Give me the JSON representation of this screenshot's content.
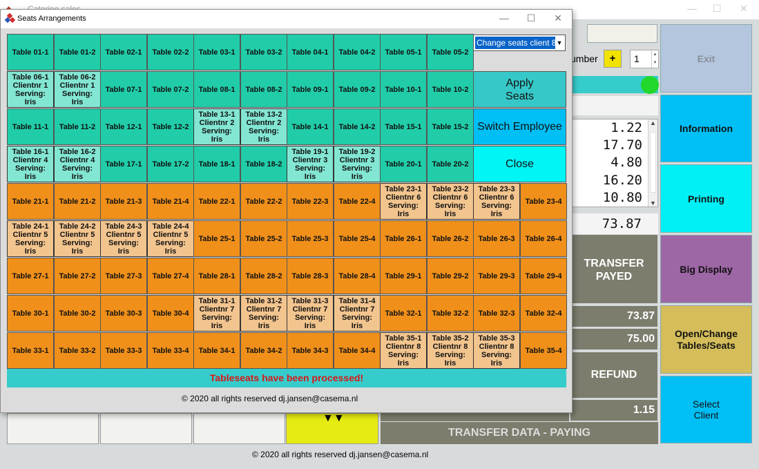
{
  "background": {
    "title": "Catering sales",
    "number_label": "umber",
    "plus_label": "+",
    "quantity": "1",
    "amounts": [
      "1.22",
      "17.70",
      "4.80",
      "16.20",
      "10.80"
    ],
    "total": "73.87",
    "transfer_payed": "TRANSFER PAYED",
    "value1": "73.87",
    "value2": "75.00",
    "refund": "REFUND",
    "value3": "1.15",
    "transfer_data": "TRANSFER DATA - PAYING",
    "side_buttons": {
      "exit": "Exit",
      "information": "Information",
      "printing": "Printing",
      "big_display": "Big Display",
      "open_change": "Open/Change Tables/Seats",
      "select_client": "Select Client"
    },
    "copyright": "© 2020 all rights reserved dj.jansen@casema.nl"
  },
  "dialog": {
    "title": "Seats Arrangements",
    "select_value": "Change seats client 8",
    "apply_label": "Apply Seats",
    "switch_label": "Switch Employee",
    "close_label": "Close",
    "status": "Tableseats have been processed!",
    "copyright": "© 2020 all rights reserved dj.jansen@casema.nl",
    "colors": {
      "teal": "#21cda9",
      "orange": "#f0901a",
      "teal_assigned": "#82e6d2",
      "orange_assigned": "#f2c48e"
    },
    "rows": [
      [
        {
          "label": "Table 01-1"
        },
        {
          "label": "Table 01-2"
        },
        {
          "label": "Table 02-1"
        },
        {
          "label": "Table 02-2"
        },
        {
          "label": "Table 03-1"
        },
        {
          "label": "Table 03-2"
        },
        {
          "label": "Table 04-1"
        },
        {
          "label": "Table 04-2"
        },
        {
          "label": "Table 05-1"
        },
        {
          "label": "Table 05-2"
        }
      ],
      [
        {
          "label": "Table 06-1",
          "client": "Clientnr 1",
          "serving": "Serving:",
          "server": "Iris"
        },
        {
          "label": "Table 06-2",
          "client": "Clientnr 1",
          "serving": "Serving:",
          "server": "Iris"
        },
        {
          "label": "Table 07-1"
        },
        {
          "label": "Table 07-2"
        },
        {
          "label": "Table 08-1"
        },
        {
          "label": "Table 08-2"
        },
        {
          "label": "Table 09-1"
        },
        {
          "label": "Table 09-2"
        },
        {
          "label": "Table 10-1"
        },
        {
          "label": "Table 10-2"
        }
      ],
      [
        {
          "label": "Table 11-1"
        },
        {
          "label": "Table 11-2"
        },
        {
          "label": "Table 12-1"
        },
        {
          "label": "Table 12-2"
        },
        {
          "label": "Table 13-1",
          "client": "Clientnr 2",
          "serving": "Serving:",
          "server": "Iris"
        },
        {
          "label": "Table 13-2",
          "client": "Clientnr 2",
          "serving": "Serving:",
          "server": "Iris"
        },
        {
          "label": "Table 14-1"
        },
        {
          "label": "Table 14-2"
        },
        {
          "label": "Table 15-1"
        },
        {
          "label": "Table 15-2"
        }
      ],
      [
        {
          "label": "Table 16-1",
          "client": "Clientnr 4",
          "serving": "Serving:",
          "server": "Iris"
        },
        {
          "label": "Table 16-2",
          "client": "Clientnr 4",
          "serving": "Serving:",
          "server": "Iris"
        },
        {
          "label": "Table 17-1"
        },
        {
          "label": "Table 17-2"
        },
        {
          "label": "Table 18-1"
        },
        {
          "label": "Table 18-2"
        },
        {
          "label": "Table 19-1",
          "client": "Clientnr 3",
          "serving": "Serving:",
          "server": "Iris"
        },
        {
          "label": "Table 19-2",
          "client": "Clientnr 3",
          "serving": "Serving:",
          "server": "Iris"
        },
        {
          "label": "Table 20-1"
        },
        {
          "label": "Table 20-2"
        }
      ],
      [
        {
          "label": "Table 21-1"
        },
        {
          "label": "Table 21-2"
        },
        {
          "label": "Table 21-3"
        },
        {
          "label": "Table 21-4"
        },
        {
          "label": "Table 22-1"
        },
        {
          "label": "Table 22-2"
        },
        {
          "label": "Table 22-3"
        },
        {
          "label": "Table 22-4"
        },
        {
          "label": "Table 23-1",
          "client": "Clientnr 6",
          "serving": "Serving:",
          "server": "Iris"
        },
        {
          "label": "Table 23-2",
          "client": "Clientnr 6",
          "serving": "Serving:",
          "server": "Iris"
        },
        {
          "label": "Table 23-3",
          "client": "Clientnr 6",
          "serving": "Serving:",
          "server": "Iris"
        },
        {
          "label": "Table 23-4"
        }
      ],
      [
        {
          "label": "Table 24-1",
          "client": "Clientnr 5",
          "serving": "Serving:",
          "server": "Iris"
        },
        {
          "label": "Table 24-2",
          "client": "Clientnr 5",
          "serving": "Serving:",
          "server": "Iris"
        },
        {
          "label": "Table 24-3",
          "client": "Clientnr 5",
          "serving": "Serving:",
          "server": "Iris"
        },
        {
          "label": "Table 24-4",
          "client": "Clientnr 5",
          "serving": "Serving:",
          "server": "Iris"
        },
        {
          "label": "Table 25-1"
        },
        {
          "label": "Table 25-2"
        },
        {
          "label": "Table 25-3"
        },
        {
          "label": "Table 25-4"
        },
        {
          "label": "Table 26-1"
        },
        {
          "label": "Table 26-2"
        },
        {
          "label": "Table 26-3"
        },
        {
          "label": "Table 26-4"
        }
      ],
      [
        {
          "label": "Table 27-1"
        },
        {
          "label": "Table 27-2"
        },
        {
          "label": "Table 27-3"
        },
        {
          "label": "Table 27-4"
        },
        {
          "label": "Table 28-1"
        },
        {
          "label": "Table 28-2"
        },
        {
          "label": "Table 28-3"
        },
        {
          "label": "Table 28-4"
        },
        {
          "label": "Table 29-1"
        },
        {
          "label": "Table 29-2"
        },
        {
          "label": "Table 29-3"
        },
        {
          "label": "Table 29-4"
        }
      ],
      [
        {
          "label": "Table 30-1"
        },
        {
          "label": "Table 30-2"
        },
        {
          "label": "Table 30-3"
        },
        {
          "label": "Table 30-4"
        },
        {
          "label": "Table 31-1",
          "client": "Clientnr 7",
          "serving": "Serving:",
          "server": "Iris"
        },
        {
          "label": "Table 31-2",
          "client": "Clientnr 7",
          "serving": "Serving:",
          "server": "Iris"
        },
        {
          "label": "Table 31-3",
          "client": "Clientnr 7",
          "serving": "Serving:",
          "server": "Iris"
        },
        {
          "label": "Table 31-4",
          "client": "Clientnr 7",
          "serving": "Serving:",
          "server": "Iris"
        },
        {
          "label": "Table 32-1"
        },
        {
          "label": "Table 32-2"
        },
        {
          "label": "Table 32-3"
        },
        {
          "label": "Table 32-4"
        }
      ],
      [
        {
          "label": "Table 33-1"
        },
        {
          "label": "Table 33-2"
        },
        {
          "label": "Table 33-3"
        },
        {
          "label": "Table 33-4"
        },
        {
          "label": "Table 34-1"
        },
        {
          "label": "Table 34-2"
        },
        {
          "label": "Table 34-3"
        },
        {
          "label": "Table 34-4"
        },
        {
          "label": "Table 35-1",
          "client": "Clientnr 8",
          "serving": "Serving:",
          "server": "Iris"
        },
        {
          "label": "Table 35-2",
          "client": "Clientnr 8",
          "serving": "Serving:",
          "server": "Iris"
        },
        {
          "label": "Table 35-3",
          "client": "Clientnr 8",
          "serving": "Serving:",
          "server": "Iris"
        },
        {
          "label": "Table 35-4"
        }
      ]
    ]
  }
}
